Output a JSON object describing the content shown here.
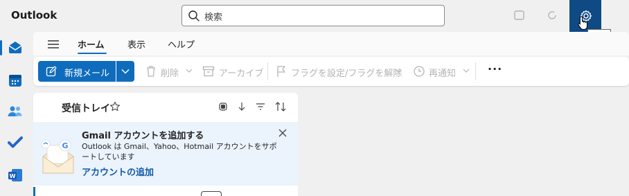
{
  "app": {
    "title": "Outlook"
  },
  "search": {
    "placeholder": "検索"
  },
  "settings": {
    "tooltip": "設定"
  },
  "ribbon": {
    "tabs": [
      {
        "label": "ホーム",
        "active": true
      },
      {
        "label": "表示",
        "active": false
      },
      {
        "label": "ヘルプ",
        "active": false
      }
    ]
  },
  "toolbar": {
    "new_mail": "新規メール",
    "delete": "削除",
    "archive": "アーカイブ",
    "flag": "フラグを設定/フラグを解除",
    "snooze": "再通知",
    "more": "···"
  },
  "mail_list": {
    "folder_title": "受信トレイ"
  },
  "banner": {
    "title": "Gmail アカウントを追加する",
    "text": "Outlook は Gmail、Yahoo、Hotmail アカウントをサポートしています",
    "link": "アカウントの追加"
  },
  "colors": {
    "accent": "#0f6cbd",
    "settings_bg": "#0f4a85",
    "banner_bg": "#ebf3fc"
  },
  "rail": {
    "items": [
      "mail-icon",
      "calendar-icon",
      "people-icon",
      "todo-icon",
      "word-icon"
    ]
  }
}
